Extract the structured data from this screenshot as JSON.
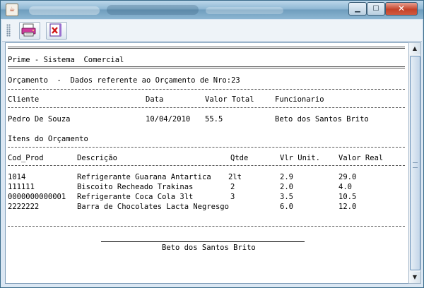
{
  "window": {
    "title": "",
    "controls": {
      "minimize": "▁",
      "maximize": "☐",
      "close": "✕"
    }
  },
  "toolbar": {
    "print_icon": "print-icon",
    "close_icon": "close-report-icon"
  },
  "report": {
    "system_name": "Prime - Sistema  Comercial",
    "quote_header": "Orçamento  -  Dados referente ao Orçamento de Nro:23",
    "client_headers": {
      "cliente": "Cliente",
      "data": "Data",
      "valor_total": "Valor Total",
      "funcionario": "Funcionario"
    },
    "client_row": {
      "cliente": "Pedro De Souza",
      "data": "10/04/2010",
      "valor_total": "55.5",
      "funcionario": "Beto dos Santos Brito"
    },
    "items_title": "Itens do Orçamento",
    "item_headers": {
      "cod": "Cod_Prod",
      "descricao": "Descrição",
      "qtde": "Qtde",
      "vlr_unit": "Vlr Unit.",
      "valor_real": "Valor Real"
    },
    "items": [
      {
        "cod": "1014",
        "descricao": "Refrigerante Guarana Antartica",
        "qtde": "2lt",
        "vlr_unit": "2.9",
        "valor_real": "29.0"
      },
      {
        "cod": "111111",
        "descricao": "Biscoito Recheado Trakinas",
        "qtde": "2",
        "vlr_unit": "2.0",
        "valor_real": "4.0"
      },
      {
        "cod": "0000000000001",
        "descricao": "Refrigerante Coca Cola 3lt",
        "qtde": "3",
        "vlr_unit": "3.5",
        "valor_real": "10.5"
      },
      {
        "cod": "2222222",
        "descricao": "Barra de Chocolates Lacta Negresgo",
        "qtde": "",
        "vlr_unit": "6.0",
        "valor_real": "12.0"
      }
    ],
    "signature_name": "Beto dos Santos Brito"
  },
  "scrollbar": {
    "up": "▲",
    "down": "▼"
  }
}
